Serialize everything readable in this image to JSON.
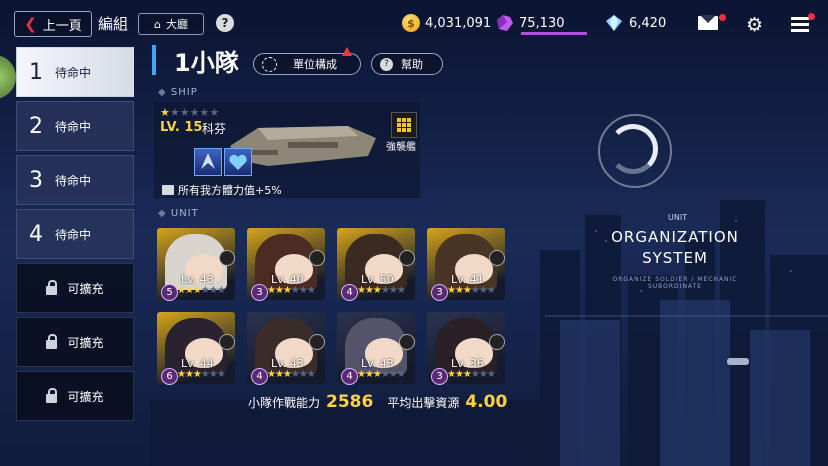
{
  "top_bar": {
    "back_label": "上一頁",
    "title": "編組",
    "lobby_label": "大廳",
    "help_glyph": "?",
    "gold": "4,031,091",
    "crystal": "75,130",
    "diamond": "6,420"
  },
  "squad_list": [
    {
      "num": "1",
      "status": "待命中",
      "active": true
    },
    {
      "num": "2",
      "status": "待命中"
    },
    {
      "num": "3",
      "status": "待命中"
    },
    {
      "num": "4",
      "status": "待命中"
    },
    {
      "label": "可擴充"
    },
    {
      "label": "可擴充"
    },
    {
      "label": "可擴充"
    }
  ],
  "squad": {
    "title": "1小隊",
    "unit_config_label": "單位構成",
    "help_label": "幫助"
  },
  "ship": {
    "section_label": "SHIP",
    "stars_filled": 1,
    "stars_total": 6,
    "level": "LV. 15",
    "name": "科芬",
    "class_label": "強襲艦",
    "buff_text": "所有我方體力值+5%"
  },
  "unit_section_label": "UNIT",
  "characters": [
    {
      "level": "Lv. 43",
      "rank": "5",
      "stars": 3
    },
    {
      "level": "Lv. 40",
      "rank": "3",
      "stars": 3
    },
    {
      "level": "Lv. 50",
      "rank": "4",
      "stars": 3
    },
    {
      "level": "Lv. 41",
      "rank": "3",
      "stars": 3
    },
    {
      "level": "Lv. 44",
      "rank": "6",
      "stars": 3
    },
    {
      "level": "Lv. 43",
      "rank": "4",
      "stars": 3
    },
    {
      "level": "Lv. 43",
      "rank": "4",
      "stars": 3
    },
    {
      "level": "Lv. 36",
      "rank": "3",
      "stars": 3
    }
  ],
  "stats": {
    "power_label": "小隊作戰能力",
    "power_value": "2586",
    "resource_label": "平均出擊資源",
    "resource_value": "4.00"
  },
  "unit_panel": {
    "small_label": "UNIT",
    "title": "ORGANIZATION SYSTEM",
    "subtitle": "ORGANIZE SOLDIER / MECHANIC SUBORDINATE"
  },
  "colors": {
    "accent_blue": "#3fa6ff",
    "gold": "#ffd23f",
    "crystal_purple": "#b04fe0",
    "notification_red": "#ff2d3f",
    "back_chevron": "#e8304a"
  },
  "icons": {
    "back": "chevron-left-icon",
    "lobby": "home-icon",
    "gold": "gold-coin-icon",
    "crystal": "purple-crystal-icon",
    "diamond": "diamond-icon",
    "mail": "mail-icon",
    "settings": "gear-icon",
    "menu": "hamburger-menu-icon",
    "lock": "lock-icon"
  }
}
